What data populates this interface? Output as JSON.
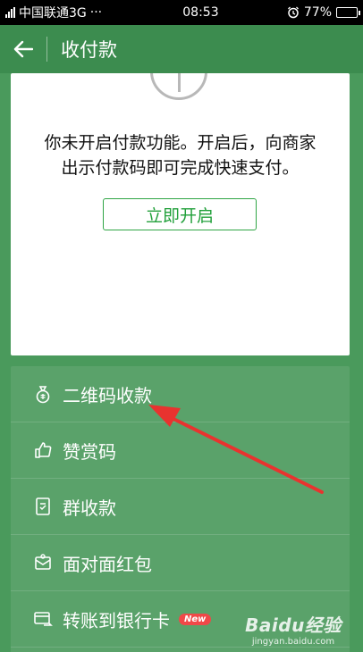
{
  "status_bar": {
    "carrier": "中国联通3G",
    "dots": "···",
    "time": "08:53",
    "battery": "77%",
    "battery_level": 0.77
  },
  "nav": {
    "title": "收付款"
  },
  "card": {
    "notice_line1": "你未开启付款功能。开启后，向商家",
    "notice_line2": "出示付款码即可完成快速支付。",
    "enable_button": "立即开启"
  },
  "menu": {
    "items": [
      {
        "label": "二维码收款",
        "icon": "money-bag-icon"
      },
      {
        "label": "赞赏码",
        "icon": "thumbs-up-icon"
      },
      {
        "label": "群收款",
        "icon": "group-bill-icon"
      },
      {
        "label": "面对面红包",
        "icon": "red-envelope-icon"
      },
      {
        "label": "转账到银行卡",
        "icon": "bank-card-transfer-icon",
        "badge": "New"
      }
    ]
  },
  "watermark": {
    "logo": "Baidu经验",
    "url": "jingyan.baidu.com"
  },
  "colors": {
    "background": "#4a9a5c",
    "nav": "#3c8c4f",
    "menu": "#5aa26a",
    "accent_green": "#22a03b",
    "annotation_red": "#e8332f",
    "badge_red": "#f04848"
  }
}
